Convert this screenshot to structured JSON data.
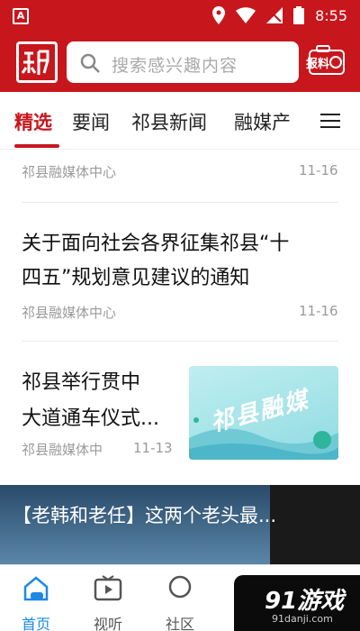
{
  "status_bar": {
    "time": "8:55",
    "app_letter": "A"
  },
  "header": {
    "logo_text": "祁",
    "search_placeholder": "搜索感兴趣内容",
    "report_label": "报料"
  },
  "tabs": [
    {
      "label": "精选",
      "active": true
    },
    {
      "label": "要闻",
      "active": false
    },
    {
      "label": "祁县新闻",
      "active": false
    },
    {
      "label": "融媒产",
      "active": false
    }
  ],
  "feed": {
    "item0": {
      "source": "祁县融媒体中心",
      "date": "11-16"
    },
    "item1": {
      "title_line1": "关于面向社会各界征集祁县“十",
      "title_line2": "四五”规划意见建议的通知",
      "source": "祁县融媒体中心",
      "date": "11-16"
    },
    "item2": {
      "title_line1": "祁县举行贯中",
      "title_line2": "大道通车仪式...",
      "source": "祁县融媒体中",
      "date": "11-13",
      "thumb_text": "祁县融媒"
    },
    "watermark": "91游戏"
  },
  "banner": {
    "title": "【老韩和老任】这两个老头最..."
  },
  "bottom_nav": [
    {
      "label": "首页",
      "icon": "home-icon",
      "active": true
    },
    {
      "label": "视听",
      "icon": "video-icon",
      "active": false
    },
    {
      "label": "社区",
      "icon": "community-icon",
      "active": false
    }
  ],
  "overlay": {
    "brand": "91游戏",
    "url": "91danji.com"
  },
  "colors": {
    "brand_red": "#c8161d",
    "active_blue": "#1e88e5"
  }
}
